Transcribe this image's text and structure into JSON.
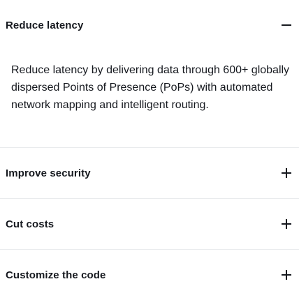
{
  "accordion": {
    "items": [
      {
        "title": "Reduce latency",
        "expanded": true,
        "toggle_icon": "minus-icon",
        "body": "Reduce latency by delivering data through 600+ globally dispersed Points of Presence (PoPs) with automated network mapping and intelligent routing."
      },
      {
        "title": "Improve security",
        "expanded": false,
        "toggle_icon": "plus-icon"
      },
      {
        "title": "Cut costs",
        "expanded": false,
        "toggle_icon": "plus-icon"
      },
      {
        "title": "Customize the code",
        "expanded": false,
        "toggle_icon": "plus-icon"
      }
    ]
  },
  "colors": {
    "text": "#16191f",
    "divider": "#e9ebed",
    "background": "#ffffff"
  }
}
